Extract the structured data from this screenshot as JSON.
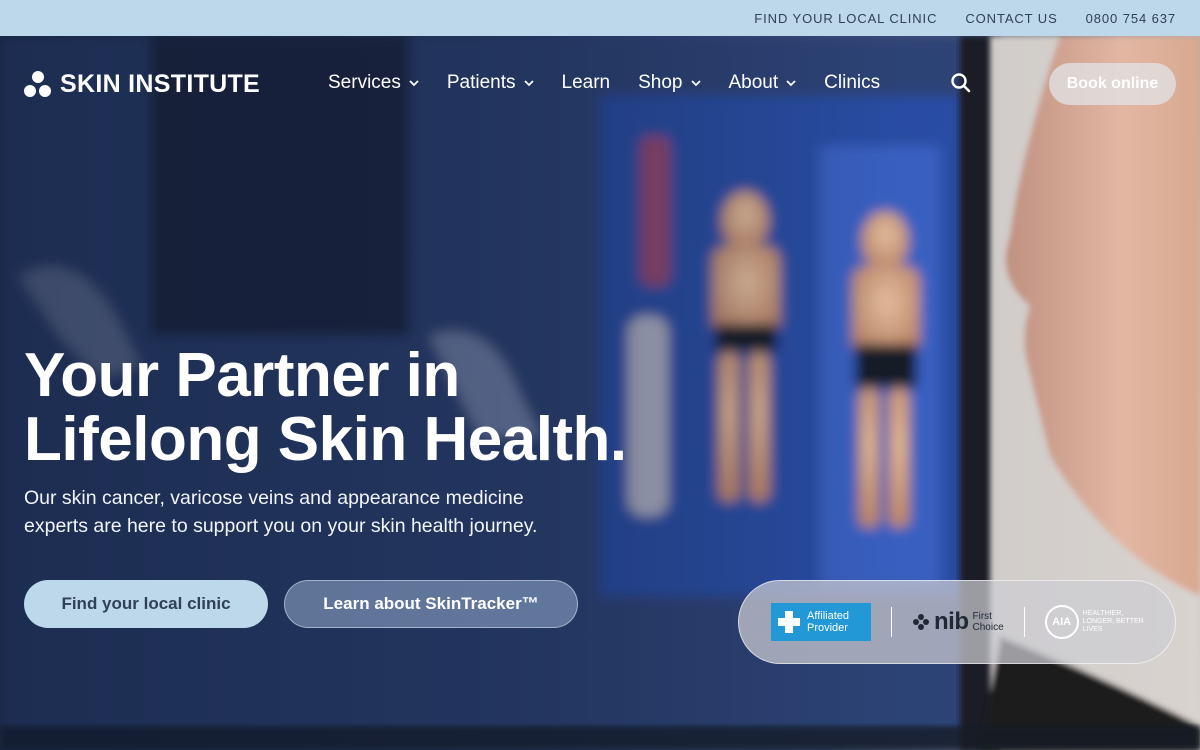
{
  "utility": {
    "links": [
      "FIND YOUR LOCAL CLINIC",
      "CONTACT US",
      "0800 754 637"
    ]
  },
  "nav": {
    "logo_text": "SKIN INSTITUTE",
    "items": [
      {
        "label": "Services",
        "has_dropdown": true
      },
      {
        "label": "Patients",
        "has_dropdown": true
      },
      {
        "label": "Learn",
        "has_dropdown": false
      },
      {
        "label": "Shop",
        "has_dropdown": true
      },
      {
        "label": "About",
        "has_dropdown": true
      },
      {
        "label": "Clinics",
        "has_dropdown": false
      }
    ],
    "search_icon": "search-icon",
    "book_label": "Book online"
  },
  "hero": {
    "title_line1": "Your Partner in",
    "title_line2": "Lifelong Skin Health.",
    "subtitle": "Our skin cancer, varicose veins and appearance medicine experts are here to support you on your skin health journey.",
    "primary_cta": "Find your local clinic",
    "secondary_cta": "Learn about SkinTracker™"
  },
  "partners": {
    "affiliated_line1": "Affiliated",
    "affiliated_line2": "Provider",
    "nib_word": "nib",
    "nib_sub1": "First",
    "nib_sub2": "Choice",
    "aia_letters": "AIA",
    "aia_tagline": "HEALTHIER, LONGER, BETTER LIVES"
  },
  "colors": {
    "utility_bar": "#bcd8ea",
    "utility_text": "#2f4256",
    "primary_button": "#bcd8ea",
    "affiliated_blue": "#2398d6"
  }
}
